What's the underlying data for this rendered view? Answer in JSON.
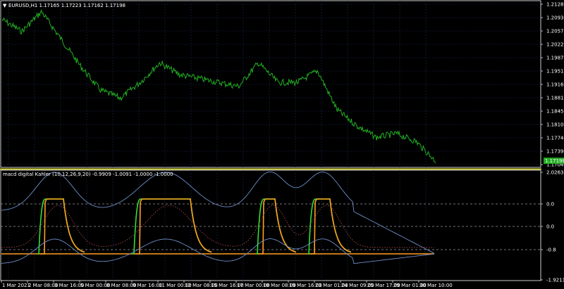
{
  "window": {
    "chart_title": "EURUSD,H1  1.17165 1.17223 1.17162 1.17198",
    "menu_marker": "▼",
    "indicator_title": "macd digital Kahler (10,12,26,9,20) -0.9909 -1.0091 -1.0000 -1.0000"
  },
  "price_axis": {
    "ticks": [
      "1.21280",
      "1.20930",
      "1.20570",
      "1.20220",
      "1.19870",
      "1.19510",
      "1.19160",
      "1.18810",
      "1.18450",
      "1.18100",
      "1.17740",
      "1.17390",
      "1.17040"
    ],
    "current_price": "1.17198"
  },
  "indicator_axis": {
    "ticks": [
      "2.0263",
      "0.0",
      "0.0",
      "-0.8",
      "-1.9211"
    ]
  },
  "time_axis": {
    "ticks": [
      "1 Mar 2021",
      "2 Mar 08:00",
      "3 Mar 16:00",
      "5 Mar 00:00",
      "8 Mar 08:00",
      "9 Mar 16:00",
      "11 Mar 00:00",
      "12 Mar 08:00",
      "15 Mar 16:00",
      "17 Mar 00:00",
      "18 Mar 08:00",
      "19 Mar 16:00",
      "23 Mar 01:00",
      "24 Mar 09:00",
      "25 Mar 17:00",
      "29 Mar 01:00",
      "30 Mar 10:00"
    ]
  },
  "colors": {
    "background": "#000000",
    "grid": "#1c2a55",
    "axis": "#ffffff",
    "price_line": "#22b022",
    "separator": "#c8c832",
    "macd_green": "#33dd33",
    "signal_orange": "#ffa020",
    "band_blue": "#6f8fc8",
    "dotted_red": "#c05050",
    "current_bg": "#22aa22"
  },
  "chart_data": {
    "type": "line",
    "title": "EURUSD,H1",
    "ylim": [
      1.1704,
      1.2128
    ],
    "series": [
      {
        "name": "EURUSD,H1",
        "x": [
          "1 Mar",
          "2 Mar",
          "3 Mar",
          "4 Mar",
          "5 Mar",
          "8 Mar",
          "9 Mar",
          "10 Mar",
          "11 Mar",
          "12 Mar",
          "15 Mar",
          "16 Mar",
          "17 Mar",
          "18 Mar",
          "19 Mar",
          "22 Mar",
          "23 Mar",
          "24 Mar",
          "25 Mar",
          "26 Mar",
          "29 Mar",
          "30 Mar",
          "31 Mar"
        ],
        "values": [
          1.208,
          1.205,
          1.21,
          1.203,
          1.196,
          1.19,
          1.188,
          1.192,
          1.197,
          1.194,
          1.193,
          1.192,
          1.191,
          1.197,
          1.192,
          1.192,
          1.195,
          1.185,
          1.181,
          1.178,
          1.179,
          1.177,
          1.172
        ]
      }
    ]
  }
}
